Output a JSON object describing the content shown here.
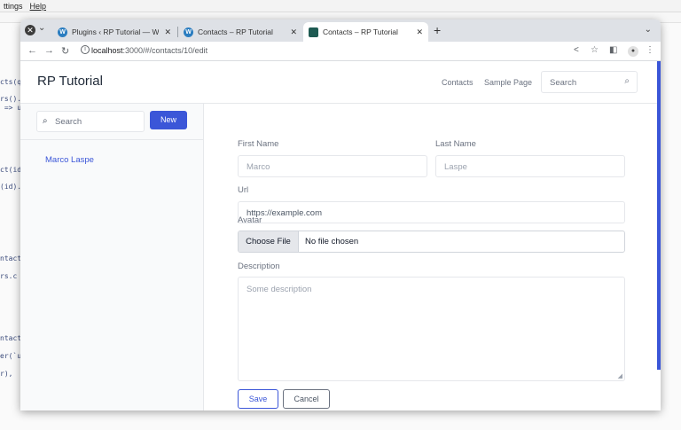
{
  "desktop": {
    "menu": [
      {
        "label": "ttings"
      },
      {
        "label": "Help"
      }
    ],
    "code_fragments": [
      "cts(q",
      "rs().",
      " => u",
      "ct(id",
      "(id).",
      "ntact",
      "rs.c",
      "ntact",
      "er(`u",
      "r),"
    ]
  },
  "browser": {
    "tabs": [
      {
        "title": "Plugins ‹ RP Tutorial — Word",
        "favicon": "wordpress-icon",
        "close": "✕"
      },
      {
        "title": "Contacts – RP Tutorial",
        "favicon": "wordpress-icon",
        "close": "✕"
      },
      {
        "title": "Contacts – RP Tutorial",
        "favicon": "app-icon",
        "close": "✕",
        "active": true
      }
    ],
    "new_tab": "+",
    "url_host": "localhost",
    "url_path": ":3000/#/contacts/10/edit"
  },
  "app": {
    "brand": "RP Tutorial",
    "header_links": [
      "Contacts",
      "Sample Page"
    ],
    "header_search_placeholder": "Search",
    "sidebar": {
      "search_placeholder": "Search",
      "new_button": "New",
      "contacts": [
        "Marco Laspe"
      ]
    },
    "form": {
      "first_name_label": "First Name",
      "first_name_value": "Marco",
      "last_name_label": "Last Name",
      "last_name_value": "Laspe",
      "url_label": "Url",
      "url_placeholder": "https://example.com",
      "avatar_label": "Avatar",
      "file_button": "Choose File",
      "file_status": "No file chosen",
      "description_label": "Description",
      "description_placeholder": "Some description",
      "save_button": "Save",
      "cancel_button": "Cancel"
    }
  },
  "colors": {
    "accent": "#3b56d8"
  }
}
